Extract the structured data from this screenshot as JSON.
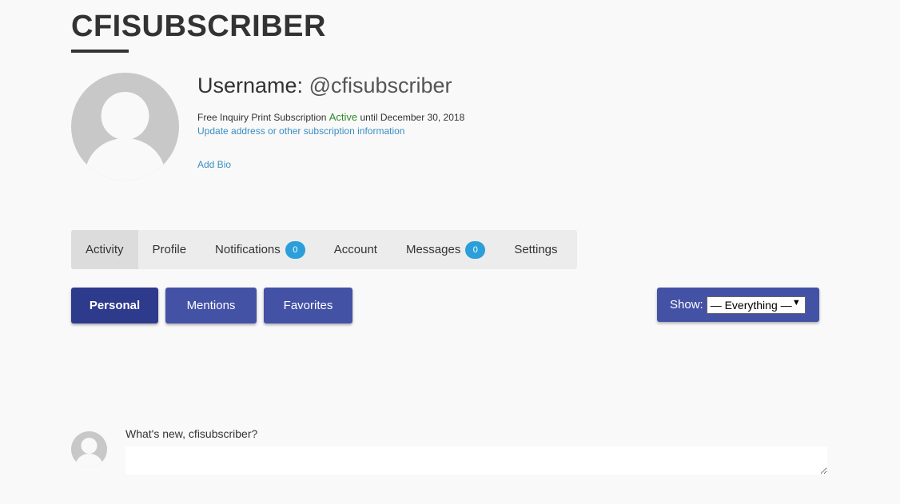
{
  "header": {
    "title": "CFISUBSCRIBER"
  },
  "profile": {
    "username_label": "Username:",
    "username_handle": "@cfisubscriber",
    "subscription_prefix": "Free Inquiry Print Subscription",
    "subscription_status": "Active",
    "subscription_suffix": "until December 30, 2018",
    "update_link": "Update address or other subscription information",
    "add_bio_link": "Add Bio",
    "avatar_icon": "user-avatar-icon"
  },
  "nav": {
    "tabs": [
      {
        "label": "Activity"
      },
      {
        "label": "Profile"
      },
      {
        "label": "Notifications",
        "count": "0"
      },
      {
        "label": "Account"
      },
      {
        "label": "Messages",
        "count": "0"
      },
      {
        "label": "Settings"
      }
    ]
  },
  "subnav": {
    "personal": "Personal",
    "mentions": "Mentions",
    "favorites": "Favorites"
  },
  "filter": {
    "label": "Show:",
    "selected": "— Everything —"
  },
  "post": {
    "prompt": "What's new, cfisubscriber?",
    "textarea_value": ""
  },
  "colors": {
    "primary_button": "#4452a6",
    "active_button": "#2e3a8c",
    "badge": "#2b9fd9",
    "link": "#3b8ec2",
    "active_status": "#2e8b2e"
  }
}
